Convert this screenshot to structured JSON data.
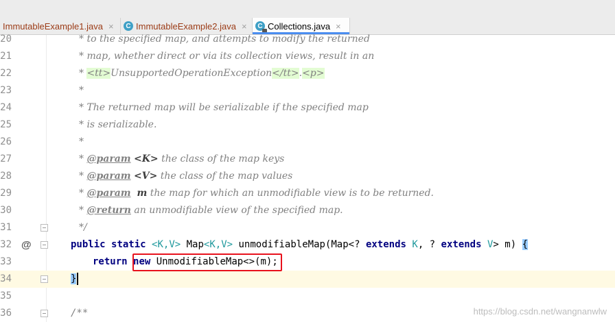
{
  "tabs": [
    {
      "label": "ImmutableExample1.java",
      "close": "×",
      "active": false
    },
    {
      "label": "ImmutableExample2.java",
      "close": "×",
      "active": false
    },
    {
      "label": "Collections.java",
      "close": "×",
      "active": true
    }
  ],
  "class_icon_letter": "C",
  "lines": {
    "l20": {
      "num": "20",
      "text": "* to the specified map, and attempts to modify the returned"
    },
    "l21": {
      "num": "21",
      "text": "* map, whether direct or via its collection views, result in an"
    },
    "l22": {
      "num": "22",
      "lead": "* ",
      "tt_open": "<tt>",
      "mid": "UnsupportedOperationException",
      "tt_close": "</tt>",
      "dot": ".",
      "p_tag": "<p>"
    },
    "l23": {
      "num": "23",
      "text": "*"
    },
    "l24": {
      "num": "24",
      "text": "* The returned map will be serializable if the specified map"
    },
    "l25": {
      "num": "25",
      "text": "* is serializable."
    },
    "l26": {
      "num": "26",
      "text": "*"
    },
    "l27": {
      "num": "27",
      "lead": "* ",
      "tag": "@param",
      "param": "<K>",
      "desc": " the class of the map keys"
    },
    "l28": {
      "num": "28",
      "lead": "* ",
      "tag": "@param",
      "param": "<V>",
      "desc": " the class of the map values"
    },
    "l29": {
      "num": "29",
      "lead": "* ",
      "tag": "@param",
      "param": "m",
      "desc": " the map for which an unmodifiable view is to be returned."
    },
    "l30": {
      "num": "30",
      "lead": "* ",
      "tag": "@return",
      "desc": " an unmodifiable view of the specified map."
    },
    "l31": {
      "num": "31",
      "text": "*/"
    },
    "l32": {
      "num": "32",
      "kw1": "public",
      "kw2": "static",
      "g1": "<K,V>",
      "t1": " Map",
      "g2": "<K,V>",
      "fn": " unmodifiableMap(Map<? ",
      "kw3": "extends",
      "k": " K",
      "c1": ", ? ",
      "kw4": "extends",
      "v": " V",
      "end": "> m) ",
      "brace": "{"
    },
    "l33": {
      "num": "33",
      "kw": "return",
      "kw2": "new",
      "rest": " UnmodifiableMap<>(m);"
    },
    "l34": {
      "num": "34",
      "brace": "}"
    },
    "l35": {
      "num": "35",
      "text": ""
    },
    "l36": {
      "num": "36",
      "text": "/**"
    }
  },
  "gutter_marker": "@",
  "watermark": "https://blog.csdn.net/wangnanwlw"
}
